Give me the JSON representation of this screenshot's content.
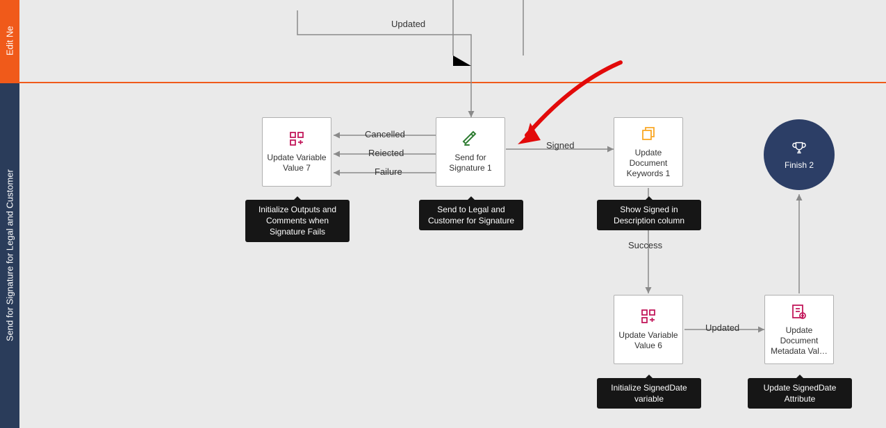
{
  "tabs": {
    "orange": "Edit Ne",
    "darkblue": "Send for Signature for Legal and Customer"
  },
  "nodes": {
    "updateVar7": "Update Variable Value 7",
    "sendSig1": "Send for Signature 1",
    "updateKeywords1": "Update Document Keywords 1",
    "updateVar6": "Update Variable Value 6",
    "updateMetadata": "Update Document Metadata Val…",
    "finish": "Finish 2"
  },
  "tooltips": {
    "updateVar7": "Initialize Outputs and Comments when Signature Fails",
    "sendSig1": "Send to Legal and Customer for Signature",
    "updateKeywords1": "Show Signed in Description column",
    "updateVar6": "Initialize SignedDate variable",
    "updateMetadata": "Update SignedDate Attribute"
  },
  "edgeLabels": {
    "updated": "Updated",
    "cancelled": "Cancelled",
    "rejected": "Reiected",
    "failure": "Failure",
    "signed": "Signed",
    "success": "Success",
    "updated2": "Updated"
  }
}
